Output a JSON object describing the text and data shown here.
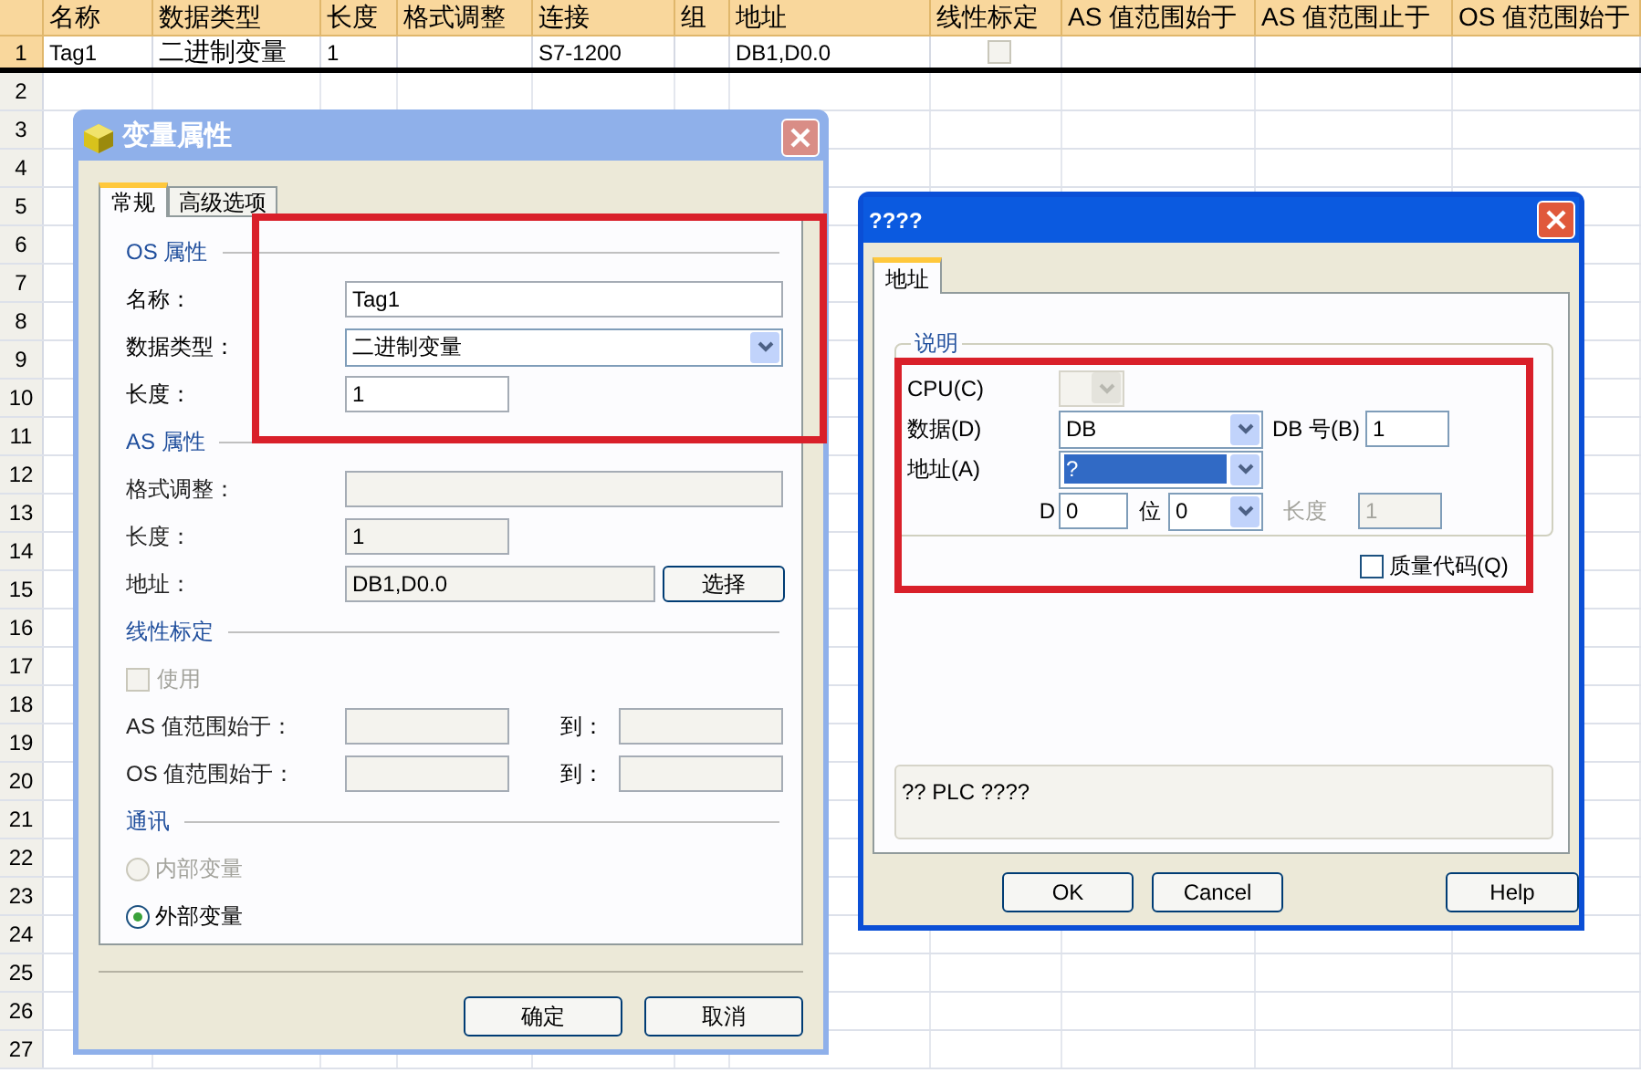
{
  "sheet": {
    "columns": [
      "名称",
      "数据类型",
      "长度",
      "格式调整",
      "连接",
      "组",
      "地址",
      "线性标定",
      "AS 值范围始于",
      "AS 值范围止于",
      "OS 值范围始于"
    ],
    "rows": [
      {
        "number": "1",
        "name": "Tag1",
        "data_type": "二进制变量",
        "length": "1",
        "connection": "S7-1200",
        "address": "DB1,D0.0",
        "linear_scaling": false
      }
    ],
    "empty_row_numbers": [
      "2",
      "3",
      "4",
      "5",
      "6",
      "7",
      "8",
      "9",
      "10",
      "11",
      "12",
      "13",
      "14",
      "15",
      "16",
      "17",
      "18",
      "19",
      "20",
      "21",
      "22",
      "23",
      "24",
      "25",
      "26",
      "27"
    ]
  },
  "tag_dialog": {
    "title": "变量属性",
    "tabs": [
      {
        "label": "常规",
        "selected": true
      },
      {
        "label": "高级选项",
        "selected": false
      }
    ],
    "sections": [
      {
        "heading": "OS 属性",
        "fields": [
          {
            "kind": "wide",
            "label": "名称：",
            "value": "Tag1",
            "disabled": false
          },
          {
            "kind": "dropdown",
            "label": "数据类型：",
            "value": "二进制变量",
            "disabled": false
          },
          {
            "kind": "short",
            "label": "长度：",
            "value": "1",
            "disabled": false
          }
        ]
      },
      {
        "heading": "AS 属性",
        "fields": [
          {
            "kind": "wide",
            "label": "格式调整：",
            "disabled": true
          },
          {
            "kind": "short",
            "label": "长度：",
            "value": "1",
            "disabled": true
          },
          {
            "kind": "address",
            "label": "地址：",
            "value": "DB1,D0.0",
            "button": "选择",
            "disabled": true
          }
        ]
      },
      {
        "heading": "线性标定",
        "fields": [
          {
            "kind": "checkbox",
            "label": "使用",
            "checked": false,
            "disabled": true
          },
          {
            "kind": "range",
            "label": "AS 值范围始于：",
            "to_label": "到：",
            "disabled": true
          },
          {
            "kind": "range",
            "label": "OS 值范围始于：",
            "to_label": "到：",
            "disabled": true
          }
        ]
      },
      {
        "heading": "通讯",
        "fields": [
          {
            "kind": "radio",
            "label": "内部变量",
            "selected": false,
            "disabled": true
          },
          {
            "kind": "radio",
            "label": "外部变量",
            "selected": true,
            "disabled": false
          }
        ]
      }
    ],
    "buttons": [
      "确定",
      "取消"
    ]
  },
  "address_dialog": {
    "title": "????",
    "tab": {
      "label": "地址",
      "selected": true
    },
    "group": "说明",
    "cpu_label": "CPU(C)",
    "data_label": "数据(D)",
    "data_value": "DB",
    "db_number_label": "DB 号(B)",
    "db_number_value": "1",
    "address_label": "地址(A)",
    "address_value": "?",
    "address_highlighted": true,
    "d_label": "D",
    "d_value": "0",
    "bit_label": "位",
    "bit_value": "0",
    "length_label": "长度",
    "length_value": "1",
    "length_disabled": true,
    "quality_code": {
      "label": "质量代码(Q)",
      "checked": false
    },
    "message": "?? PLC ????",
    "buttons": [
      "OK",
      "Cancel",
      "Help"
    ]
  }
}
